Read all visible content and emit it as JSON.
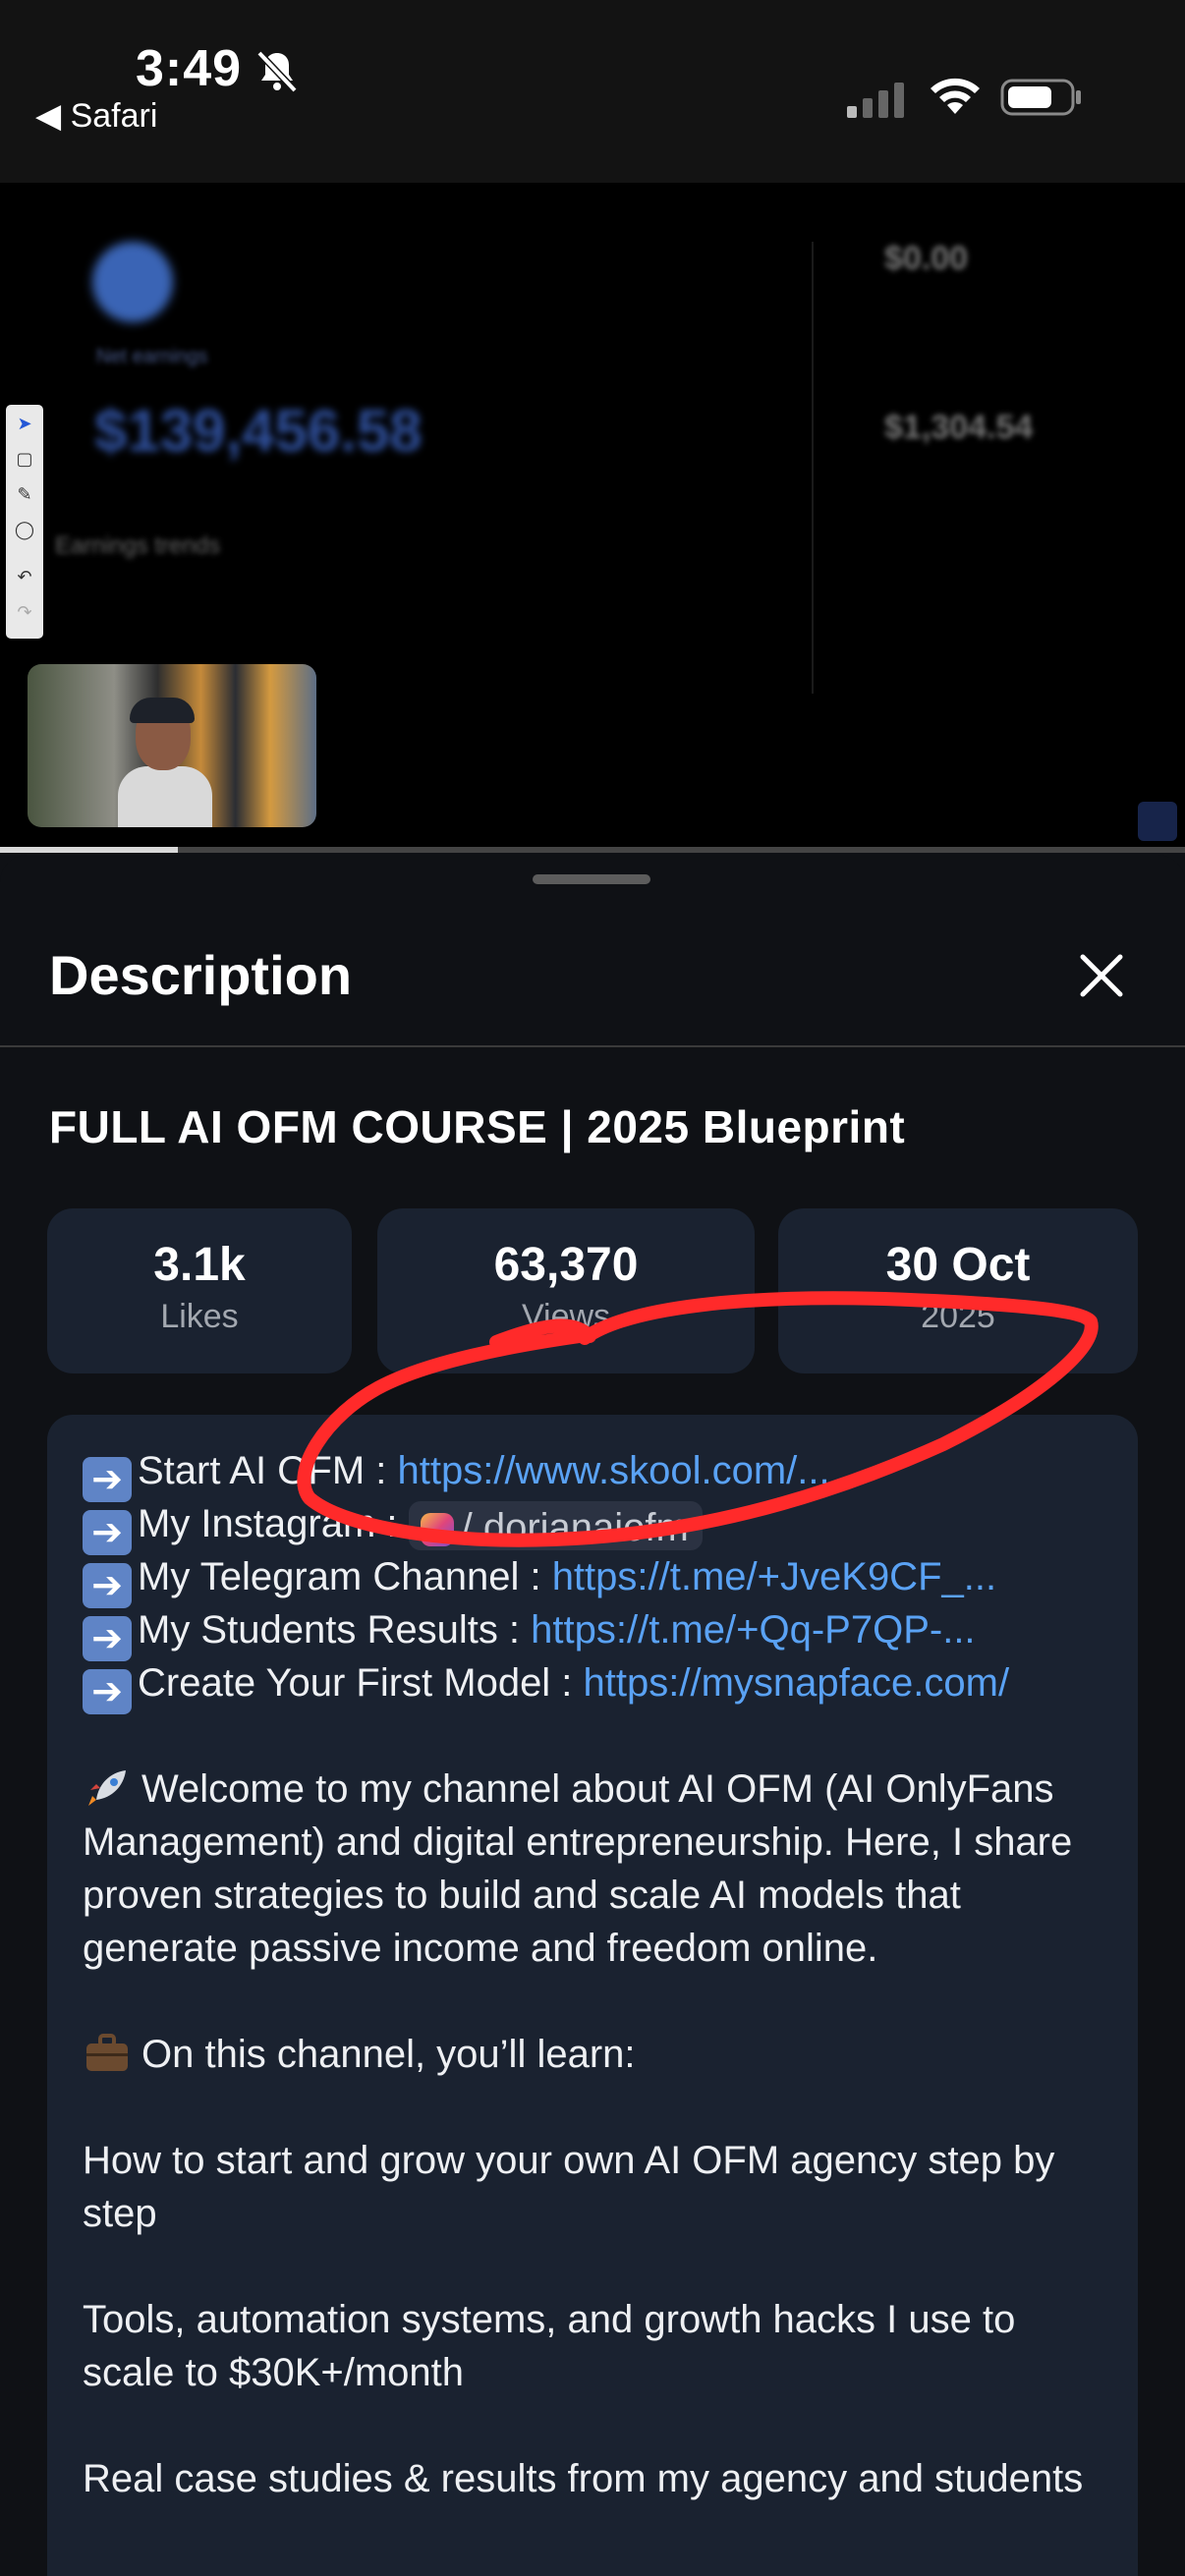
{
  "status_bar": {
    "time": "3:49",
    "back_app": "◀ Safari"
  },
  "video": {
    "blurred_earnings": "$139,456.58",
    "blurred_right_top": "$0.00",
    "blurred_right_mid": "$1,304.54",
    "blurred_label": "Earnings trends",
    "progress_fraction": 0.15
  },
  "sheet": {
    "title": "Description",
    "video_title": "FULL AI OFM COURSE | 2025 Blueprint",
    "stats": {
      "likes_value": "3.1k",
      "likes_label": "Likes",
      "views_value": "63,370",
      "views_label": "Views",
      "date_value": "30 Oct",
      "date_label": "2025"
    },
    "links": [
      {
        "label": "Start AI OFM : ",
        "url": "https://www.skool.com/..."
      },
      {
        "label": "My Instagram : ",
        "handle": "/ dorianaiofm"
      },
      {
        "label": "My Telegram Channel : ",
        "url": "https://t.me/+JveK9CF_..."
      },
      {
        "label": "My Students Results : ",
        "url": "https://t.me/+Qq-P7QP-..."
      },
      {
        "label": "Create Your First Model : ",
        "url": "https://mysnapface.com/"
      }
    ],
    "intro": "Welcome to my channel about AI OFM (AI OnlyFans Management) and digital entrepreneurship. Here, I share proven strategies to build and scale AI models that generate passive income and freedom online.",
    "learn_heading": "On this channel, you’ll learn:",
    "learn_1": "How to start and grow your own AI OFM agency step by step",
    "learn_2": "Tools, automation systems, and growth hacks I use to scale to $30K+/month",
    "learn_3": "Real case studies & results from my agency and students"
  },
  "colors": {
    "link": "#5aa2f4",
    "annotation": "#ff2a2a",
    "card": "#1a2230"
  },
  "icons": [
    "bell-muted-icon",
    "signal-icon",
    "wifi-icon",
    "battery-icon",
    "close-icon",
    "arrow-right-icon",
    "instagram-icon",
    "rocket-icon",
    "briefcase-icon"
  ]
}
